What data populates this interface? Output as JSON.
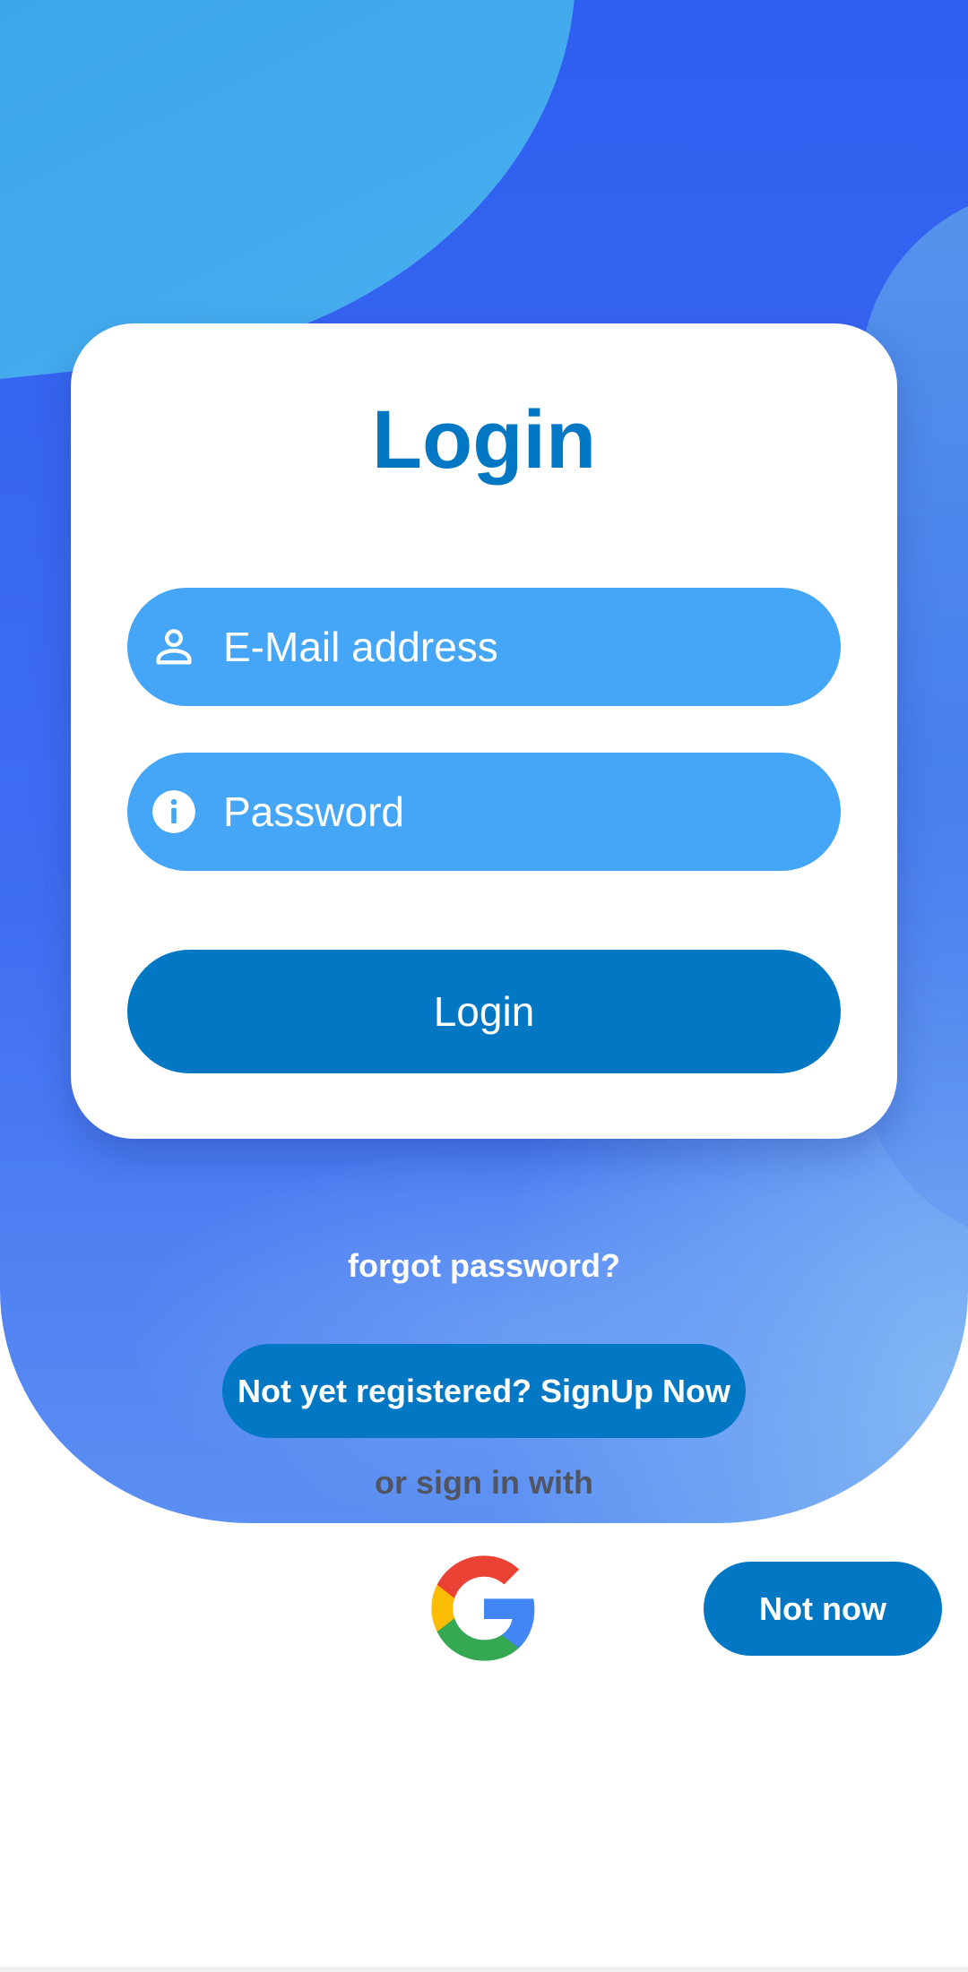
{
  "card": {
    "title": "Login",
    "email_placeholder": "E-Mail address",
    "email_icon": "person-icon",
    "password_placeholder": "Password",
    "password_icon": "info-icon",
    "login_label": "Login"
  },
  "links": {
    "forgot_password": "forgot password?",
    "signup": "Not yet registered? SignUp Now",
    "or_sign_in_with": "or sign in with",
    "not_now": "Not now"
  },
  "social": {
    "google_icon": "google-icon"
  },
  "colors": {
    "primary": "#0277c4",
    "field": "#45a6f7",
    "background_top": "#2f5ef0",
    "background_accent": "#3fa8ec"
  }
}
